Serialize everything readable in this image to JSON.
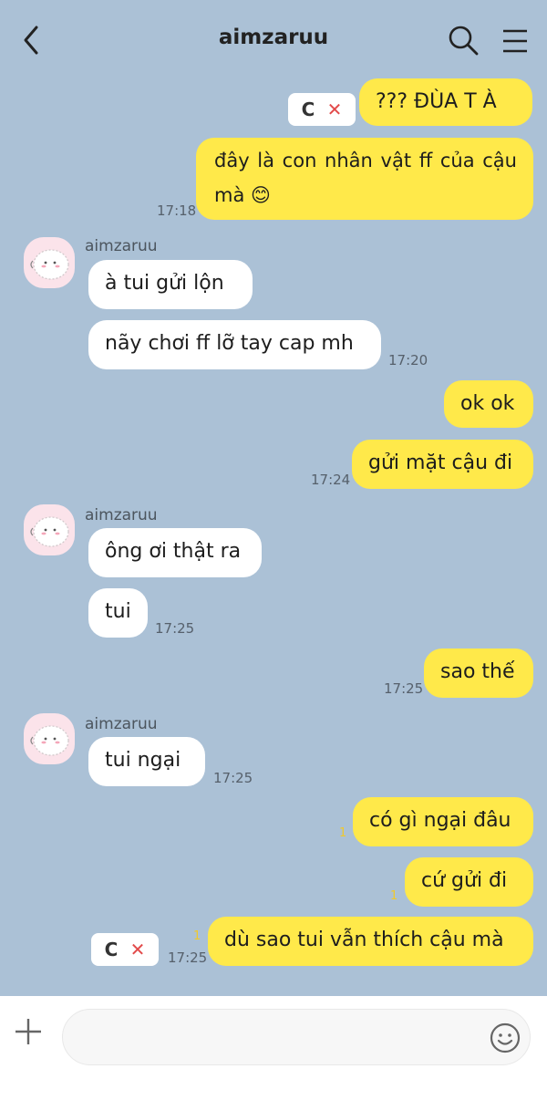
{
  "header": {
    "title": "aimzaruu",
    "back_icon": "chevron-left-icon",
    "search_icon": "search-icon",
    "menu_icon": "hamburger-menu-icon"
  },
  "failed_message_actions": {
    "retry_icon": "retry-icon",
    "delete_icon": "delete-x-icon",
    "retry_symbol": "C",
    "delete_symbol": "✕"
  },
  "messages": {
    "m1": {
      "text": "??? ĐÙA T À"
    },
    "m2": {
      "text": "đây là con nhân vật ff của cậu mà 😊",
      "time": "17:18"
    },
    "g1": {
      "sender": "aimzaruu"
    },
    "m3": {
      "text": "à tui gửi lộn"
    },
    "m4": {
      "text": "nãy chơi ff lỡ tay cap mh",
      "time": "17:20"
    },
    "m5": {
      "text": "ok ok"
    },
    "m6": {
      "text": "gửi mặt cậu đi",
      "time": "17:24"
    },
    "g2": {
      "sender": "aimzaruu"
    },
    "m7": {
      "text": "ông ơi thật ra"
    },
    "m8": {
      "text": "tui",
      "time": "17:25"
    },
    "m9": {
      "text": "sao thế",
      "time": "17:25"
    },
    "g3": {
      "sender": "aimzaruu"
    },
    "m10": {
      "text": "tui ngại",
      "time": "17:25"
    },
    "m11": {
      "text": "có gì ngại đâu",
      "unread": "1"
    },
    "m12": {
      "text": "cứ gửi đi",
      "unread": "1"
    },
    "m13": {
      "text": "dù sao tui vẫn thích cậu mà",
      "unread": "1",
      "time": "17:25"
    }
  },
  "composer": {
    "placeholder": "",
    "value": "",
    "plus_icon": "plus-icon",
    "emoji_icon": "emoji-smiley-icon"
  },
  "colors": {
    "background": "#abc1d6",
    "my_bubble": "#ffe94a",
    "their_bubble": "#ffffff",
    "unread_count": "#f0c92c",
    "delete_red": "#e24a4a"
  }
}
